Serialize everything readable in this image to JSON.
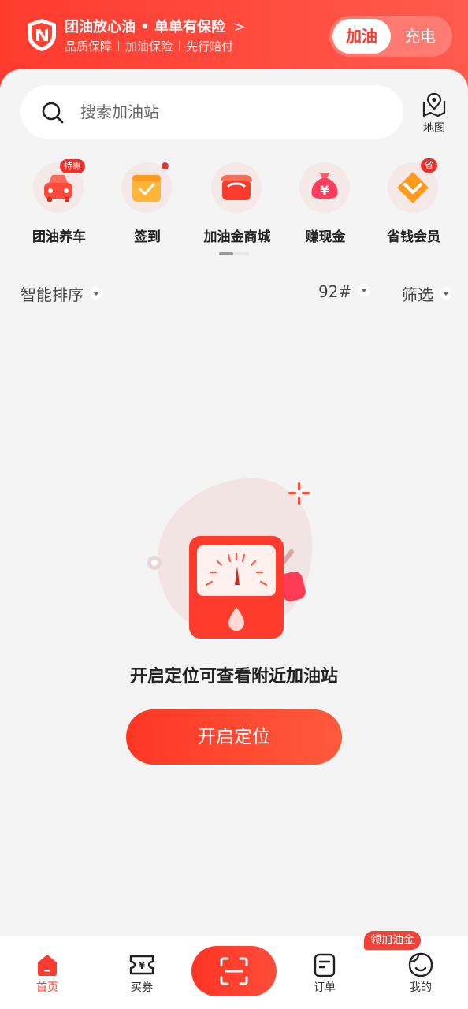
{
  "header": {
    "promo_title": "团油放心油 • 单单有保险",
    "promo_chevron": ">",
    "promo_tags": [
      "品质保障",
      "加油保险",
      "先行赔付"
    ],
    "modes": [
      {
        "label": "加油",
        "active": true
      },
      {
        "label": "充电",
        "active": false
      }
    ]
  },
  "search": {
    "placeholder": "搜索加油站",
    "map_label": "地图"
  },
  "shortcuts": [
    {
      "label": "团油养车",
      "icon": "car-icon",
      "badge": "特惠"
    },
    {
      "label": "签到",
      "icon": "calendar-check-icon",
      "badge": ""
    },
    {
      "label": "加油金商城",
      "icon": "shop-icon",
      "badge": ""
    },
    {
      "label": "赚现金",
      "icon": "money-bag-icon",
      "badge": ""
    },
    {
      "label": "省钱会员",
      "icon": "diamond-icon",
      "badge": "省"
    }
  ],
  "filters": {
    "sort": "智能排序",
    "fuel": "92#",
    "screen": "筛选"
  },
  "empty_state": {
    "message": "开启定位可查看附近加油站",
    "button": "开启定位"
  },
  "tabbar": {
    "items": [
      {
        "label": "首页",
        "icon": "home-icon",
        "active": true
      },
      {
        "label": "买券",
        "icon": "coupon-icon",
        "active": false
      },
      {
        "label": "订单",
        "icon": "order-icon",
        "active": false
      },
      {
        "label": "我的",
        "icon": "profile-icon",
        "active": false
      }
    ],
    "profile_badge": "领加油金"
  },
  "colors": {
    "brand": "#ff3b2e",
    "background": "#f4f4f4"
  }
}
